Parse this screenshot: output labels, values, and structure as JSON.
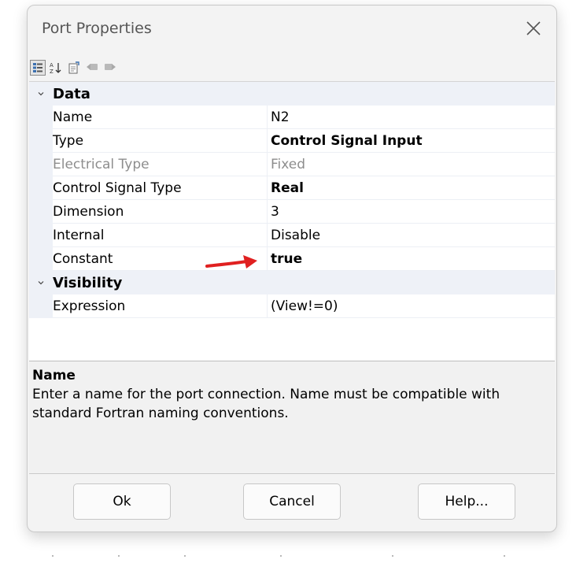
{
  "window": {
    "title": "Port Properties"
  },
  "toolbar": {
    "icons": [
      "categorized-view-icon",
      "alphabetical-sort-icon",
      "property-pages-icon",
      "previous-item-icon",
      "next-item-icon"
    ]
  },
  "grid": {
    "categories": [
      {
        "label": "Data",
        "rows": [
          {
            "name": "Name",
            "value": "N2"
          },
          {
            "name": "Type",
            "value": "Control Signal Input"
          },
          {
            "name": "Electrical Type",
            "value": "Fixed"
          },
          {
            "name": "Control Signal Type",
            "value": "Real"
          },
          {
            "name": "Dimension",
            "value": "3"
          },
          {
            "name": "Internal",
            "value": "Disable"
          },
          {
            "name": "Constant",
            "value": "true"
          }
        ]
      },
      {
        "label": "Visibility",
        "rows": [
          {
            "name": "Expression",
            "value": "(View!=0)"
          }
        ]
      }
    ]
  },
  "description": {
    "title": "Name",
    "text": "Enter a name for the port connection. Name must be compatible with standard Fortran naming conventions."
  },
  "buttons": {
    "ok": "Ok",
    "cancel": "Cancel",
    "help": "Help..."
  },
  "colors": {
    "annotation_arrow": "#e02020",
    "category_bg": "#eef1f7"
  }
}
